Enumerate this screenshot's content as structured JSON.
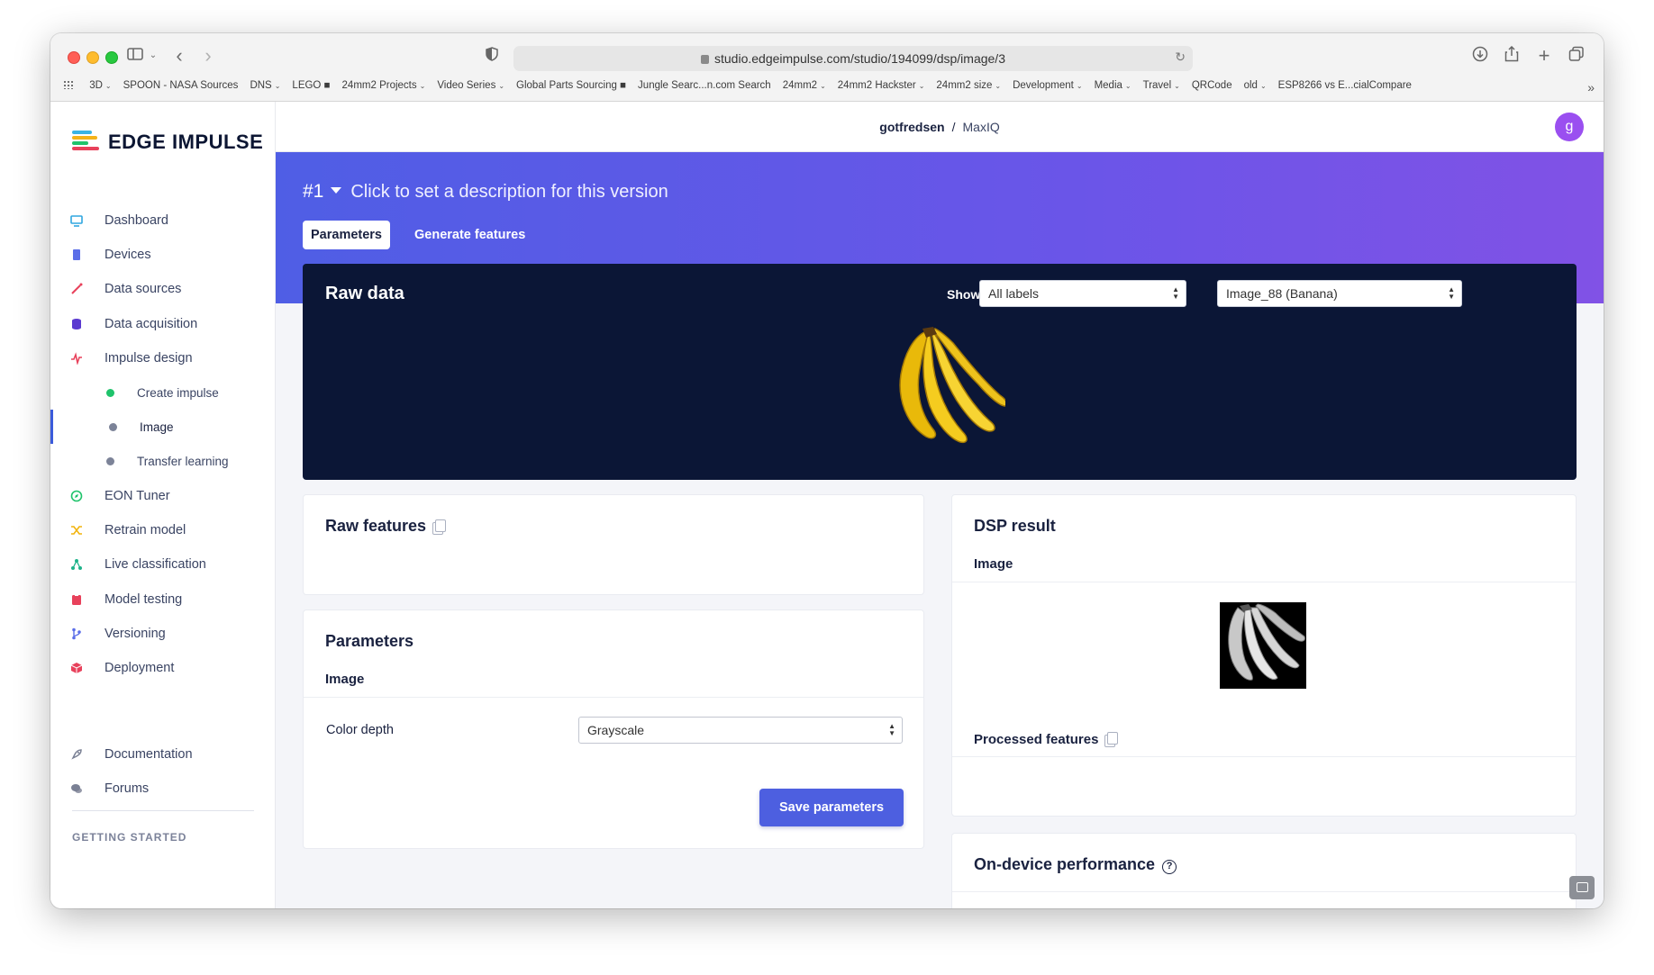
{
  "browser": {
    "url": "studio.edgeimpulse.com/studio/194099/dsp/image/3",
    "bookmarks": [
      {
        "label": "3D",
        "chevron": true
      },
      {
        "label": "SPOON - NASA Sources",
        "chevron": false
      },
      {
        "label": "DNS",
        "chevron": true
      },
      {
        "label": "LEGO ■",
        "chevron": false
      },
      {
        "label": "24mm2 Projects",
        "chevron": true
      },
      {
        "label": "Video Series",
        "chevron": true
      },
      {
        "label": "Global Parts Sourcing ■",
        "chevron": false
      },
      {
        "label": "Jungle Searc...n.com Search",
        "chevron": false
      },
      {
        "label": "24mm2",
        "chevron": true
      },
      {
        "label": "24mm2 Hackster",
        "chevron": true
      },
      {
        "label": "24mm2 size",
        "chevron": true
      },
      {
        "label": "Development",
        "chevron": true
      },
      {
        "label": "Media",
        "chevron": true
      },
      {
        "label": "Travel",
        "chevron": true
      },
      {
        "label": "QRCode",
        "chevron": false
      },
      {
        "label": "old",
        "chevron": true
      },
      {
        "label": "ESP8266 vs E...cialCompare",
        "chevron": false
      }
    ]
  },
  "brand": {
    "name": "EDGE IMPULSE"
  },
  "sidebar": {
    "items": [
      {
        "label": "Dashboard",
        "icon": "monitor-icon",
        "color": "#30a7e0"
      },
      {
        "label": "Devices",
        "icon": "chip-icon",
        "color": "#5b6ee8"
      },
      {
        "label": "Data sources",
        "icon": "magic-wand-icon",
        "color": "#e8415b"
      },
      {
        "label": "Data acquisition",
        "icon": "database-icon",
        "color": "#5b3ad0"
      },
      {
        "label": "Impulse design",
        "icon": "pulse-icon",
        "color": "#e8415b"
      }
    ],
    "sub_items": [
      {
        "label": "Create impulse",
        "dot_color": "#1fc36b"
      },
      {
        "label": "Image",
        "dot_color": "#7c8398"
      },
      {
        "label": "Transfer learning",
        "dot_color": "#7c8398"
      }
    ],
    "items2": [
      {
        "label": "EON Tuner",
        "icon": "compass-icon",
        "color": "#1fc36b"
      },
      {
        "label": "Retrain model",
        "icon": "shuffle-icon",
        "color": "#f2b30c"
      },
      {
        "label": "Live classification",
        "icon": "network-icon",
        "color": "#1fb38a"
      },
      {
        "label": "Model testing",
        "icon": "clipboard-icon",
        "color": "#e8415b"
      },
      {
        "label": "Versioning",
        "icon": "branch-icon",
        "color": "#5b6ee8"
      },
      {
        "label": "Deployment",
        "icon": "cube-icon",
        "color": "#e8415b"
      }
    ],
    "section_heading": "GETTING STARTED",
    "getting_started": [
      {
        "label": "Documentation",
        "icon": "rocket-icon"
      },
      {
        "label": "Forums",
        "icon": "chat-icon"
      }
    ]
  },
  "topbar": {
    "user": "gotfredsen",
    "separator": "/",
    "project": "MaxIQ",
    "avatar": "g"
  },
  "hero": {
    "version": "#1",
    "description": "Click to set a description for this version",
    "tabs": [
      "Parameters",
      "Generate features"
    ]
  },
  "raw_data": {
    "title": "Raw data",
    "show_label": "Show:",
    "label_filter": "All labels",
    "sample": "Image_88 (Banana)"
  },
  "raw_features": {
    "title": "Raw features"
  },
  "parameters": {
    "title": "Parameters",
    "section": "Image",
    "field_label": "Color depth",
    "field_value": "Grayscale",
    "save_label": "Save parameters"
  },
  "dsp_result": {
    "title": "DSP result",
    "section": "Image",
    "processed_label": "Processed features"
  },
  "on_device": {
    "title": "On-device performance"
  }
}
